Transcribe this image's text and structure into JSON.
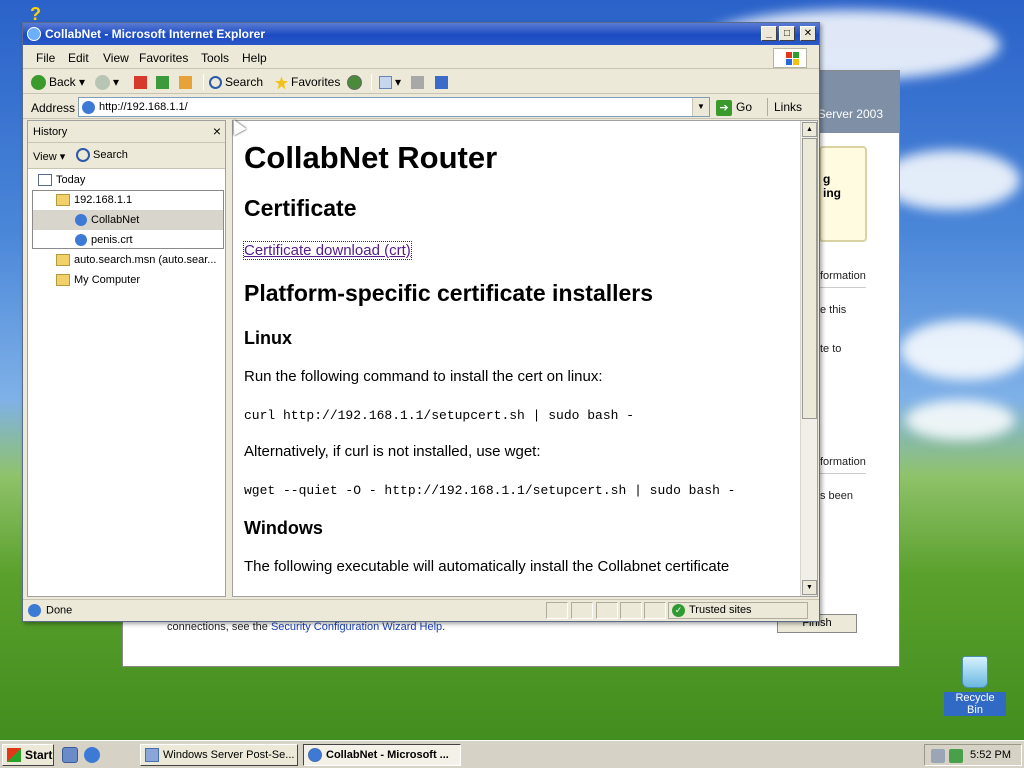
{
  "desktop": {
    "recycle_bin_label": "Recycle Bin"
  },
  "background_window": {
    "brand": "Server 2003",
    "yellow_box_text": "g\ning",
    "fragments": [
      "formation",
      "e this",
      "te to",
      "formation",
      "s been"
    ],
    "footer_text": "connections, see the ",
    "footer_link": "Security Configuration Wizard Help",
    "footer_end": ".",
    "finish_label": "Finish"
  },
  "ie_window": {
    "title": "CollabNet - Microsoft Internet Explorer",
    "menu": [
      "File",
      "Edit",
      "View",
      "Favorites",
      "Tools",
      "Help"
    ],
    "toolbar": {
      "back": "Back",
      "search": "Search",
      "favorites": "Favorites"
    },
    "address": {
      "label": "Address",
      "url": "http://192.168.1.1/",
      "go": "Go",
      "links": "Links"
    },
    "history": {
      "title": "History",
      "view": "View",
      "search": "Search",
      "items": [
        "Today",
        "192.168.1.1",
        "CollabNet",
        "penis.crt",
        "auto.search.msn (auto.sear...",
        "My Computer"
      ]
    },
    "page": {
      "h1": "CollabNet Router",
      "h2_cert": "Certificate",
      "cert_link": "Certificate download (crt)",
      "h2_platform": "Platform-specific certificate installers",
      "h3_linux": "Linux",
      "p_linux": "Run the following command to install the cert on linux:",
      "code_curl": "curl http://192.168.1.1/setupcert.sh | sudo bash -",
      "p_alt": "Alternatively, if curl is not installed, use wget:",
      "code_wget": "wget --quiet -O - http://192.168.1.1/setupcert.sh | sudo bash -",
      "h3_windows": "Windows",
      "p_windows": "The following executable will automatically install the Collabnet certificate"
    },
    "status": {
      "text": "Done",
      "zone": "Trusted sites"
    }
  },
  "taskbar": {
    "start": "Start",
    "tasks": [
      "Windows Server Post-Se...",
      "CollabNet - Microsoft ..."
    ],
    "clock": "5:52 PM"
  },
  "colors": {
    "title_bar": "#1c4bc2",
    "visited_link": "#551a8b",
    "trusted_green": "#2e9a32"
  }
}
